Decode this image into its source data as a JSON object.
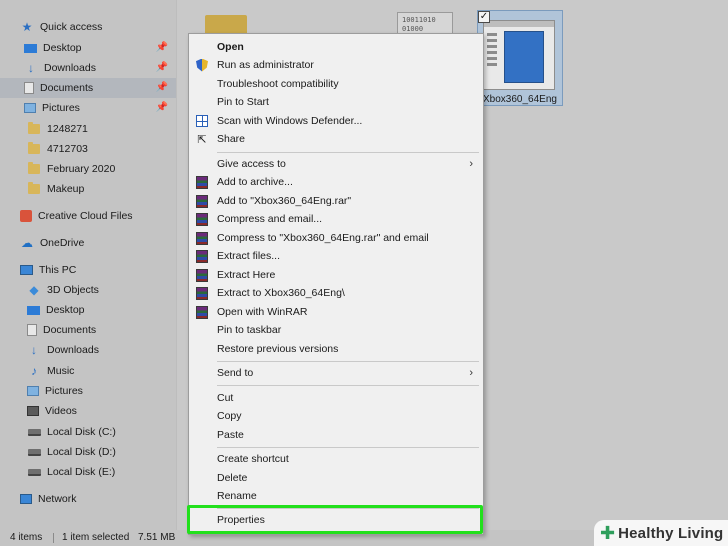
{
  "sidebar": {
    "items": [
      {
        "label": "Quick access",
        "icon": "star-icon",
        "pinned": false,
        "selected": false
      },
      {
        "label": "Desktop",
        "icon": "desktop-icon",
        "pinned": true,
        "selected": false
      },
      {
        "label": "Downloads",
        "icon": "download-icon",
        "pinned": true,
        "selected": false
      },
      {
        "label": "Documents",
        "icon": "documents-icon",
        "pinned": true,
        "selected": true
      },
      {
        "label": "Pictures",
        "icon": "pictures-icon",
        "pinned": true,
        "selected": false
      },
      {
        "label": "1248271",
        "icon": "folder-icon",
        "pinned": false,
        "selected": false
      },
      {
        "label": "4712703",
        "icon": "folder-icon",
        "pinned": false,
        "selected": false
      },
      {
        "label": "February 2020",
        "icon": "folder-icon",
        "pinned": false,
        "selected": false
      },
      {
        "label": "Makeup",
        "icon": "folder-icon",
        "pinned": false,
        "selected": false
      },
      {
        "label": "Creative Cloud Files",
        "icon": "creative-cloud-icon",
        "pinned": false,
        "selected": false
      },
      {
        "label": "OneDrive",
        "icon": "cloud-icon",
        "pinned": false,
        "selected": false
      },
      {
        "label": "This PC",
        "icon": "computer-icon",
        "pinned": false,
        "selected": false
      },
      {
        "label": "3D Objects",
        "icon": "cube-icon",
        "pinned": false,
        "selected": false
      },
      {
        "label": "Desktop",
        "icon": "desktop-icon",
        "pinned": false,
        "selected": false
      },
      {
        "label": "Documents",
        "icon": "documents-icon",
        "pinned": false,
        "selected": false
      },
      {
        "label": "Downloads",
        "icon": "download-icon",
        "pinned": false,
        "selected": false
      },
      {
        "label": "Music",
        "icon": "music-icon",
        "pinned": false,
        "selected": false
      },
      {
        "label": "Pictures",
        "icon": "pictures-icon",
        "pinned": false,
        "selected": false
      },
      {
        "label": "Videos",
        "icon": "video-icon",
        "pinned": false,
        "selected": false
      },
      {
        "label": "Local Disk (C:)",
        "icon": "drive-icon",
        "pinned": false,
        "selected": false
      },
      {
        "label": "Local Disk (D:)",
        "icon": "drive-icon",
        "pinned": false,
        "selected": false
      },
      {
        "label": "Local Disk (E:)",
        "icon": "drive-icon",
        "pinned": false,
        "selected": false
      },
      {
        "label": "Network",
        "icon": "network-icon",
        "pinned": false,
        "selected": false
      }
    ]
  },
  "content": {
    "bin_text": [
      "10011010",
      "01000"
    ],
    "selected_file": {
      "name": "Xbox360_64Eng",
      "checked": true
    }
  },
  "context_menu": {
    "items": [
      {
        "label": "Open",
        "icon": "",
        "bold": true,
        "submenu": false
      },
      {
        "label": "Run as administrator",
        "icon": "shield-icon",
        "bold": false,
        "submenu": false
      },
      {
        "label": "Troubleshoot compatibility",
        "icon": "",
        "bold": false,
        "submenu": false
      },
      {
        "label": "Pin to Start",
        "icon": "",
        "bold": false,
        "submenu": false
      },
      {
        "label": "Scan with Windows Defender...",
        "icon": "defender-icon",
        "bold": false,
        "submenu": false
      },
      {
        "label": "Share",
        "icon": "share-icon",
        "bold": false,
        "submenu": false
      },
      {
        "label": "Give access to",
        "icon": "",
        "bold": false,
        "submenu": true
      },
      {
        "label": "Add to archive...",
        "icon": "winrar-icon",
        "bold": false,
        "submenu": false
      },
      {
        "label": "Add to \"Xbox360_64Eng.rar\"",
        "icon": "winrar-icon",
        "bold": false,
        "submenu": false
      },
      {
        "label": "Compress and email...",
        "icon": "winrar-icon",
        "bold": false,
        "submenu": false
      },
      {
        "label": "Compress to \"Xbox360_64Eng.rar\" and email",
        "icon": "winrar-icon",
        "bold": false,
        "submenu": false
      },
      {
        "label": "Extract files...",
        "icon": "winrar-icon",
        "bold": false,
        "submenu": false
      },
      {
        "label": "Extract Here",
        "icon": "winrar-icon",
        "bold": false,
        "submenu": false
      },
      {
        "label": "Extract to Xbox360_64Eng\\",
        "icon": "winrar-icon",
        "bold": false,
        "submenu": false
      },
      {
        "label": "Open with WinRAR",
        "icon": "winrar-icon",
        "bold": false,
        "submenu": false
      },
      {
        "label": "Pin to taskbar",
        "icon": "",
        "bold": false,
        "submenu": false
      },
      {
        "label": "Restore previous versions",
        "icon": "",
        "bold": false,
        "submenu": false
      },
      {
        "label": "Send to",
        "icon": "",
        "bold": false,
        "submenu": true
      },
      {
        "label": "Cut",
        "icon": "",
        "bold": false,
        "submenu": false
      },
      {
        "label": "Copy",
        "icon": "",
        "bold": false,
        "submenu": false
      },
      {
        "label": "Paste",
        "icon": "",
        "bold": false,
        "submenu": false
      },
      {
        "label": "Create shortcut",
        "icon": "",
        "bold": false,
        "submenu": false
      },
      {
        "label": "Delete",
        "icon": "",
        "bold": false,
        "submenu": false
      },
      {
        "label": "Rename",
        "icon": "",
        "bold": false,
        "submenu": false
      },
      {
        "label": "Properties",
        "icon": "",
        "bold": false,
        "submenu": false,
        "highlighted": true
      }
    ]
  },
  "status_bar": {
    "item_count": "4 items",
    "selection": "1 item selected",
    "size": "7.51 MB"
  },
  "watermark": {
    "brand": "Healthy Living"
  },
  "colors": {
    "highlight": "#22e01c",
    "selection": "#b0c4d9"
  }
}
